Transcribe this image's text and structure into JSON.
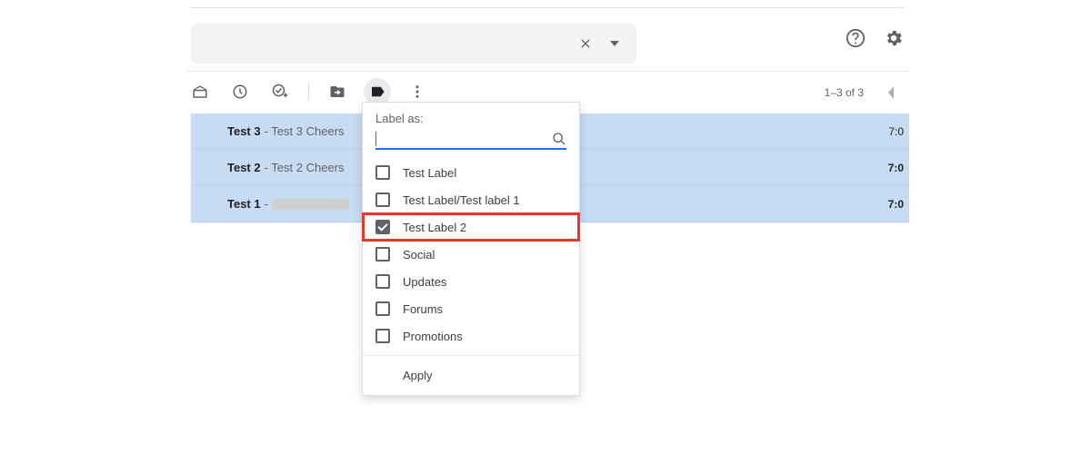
{
  "pagination": {
    "range": "1–3 of 3"
  },
  "emails": [
    {
      "subject": "Test 3",
      "snippet": "- Test 3 Cheers",
      "time": "7:0",
      "bold": false,
      "redacted": false
    },
    {
      "subject": "Test 2",
      "snippet": "- Test 2 Cheers",
      "time": "7:0",
      "bold": true,
      "redacted": false
    },
    {
      "subject": "Test 1",
      "snippet": "- ",
      "time": "7:0",
      "bold": true,
      "redacted": true
    }
  ],
  "label_popup": {
    "title": "Label as:",
    "search_placeholder": "",
    "options": [
      {
        "label": "Test Label",
        "checked": false,
        "highlight": false
      },
      {
        "label": "Test Label/Test label 1",
        "checked": false,
        "highlight": false
      },
      {
        "label": "Test Label 2",
        "checked": true,
        "highlight": true
      },
      {
        "label": "Social",
        "checked": false,
        "highlight": false
      },
      {
        "label": "Updates",
        "checked": false,
        "highlight": false
      },
      {
        "label": "Forums",
        "checked": false,
        "highlight": false
      },
      {
        "label": "Promotions",
        "checked": false,
        "highlight": false
      }
    ],
    "apply_label": "Apply"
  }
}
